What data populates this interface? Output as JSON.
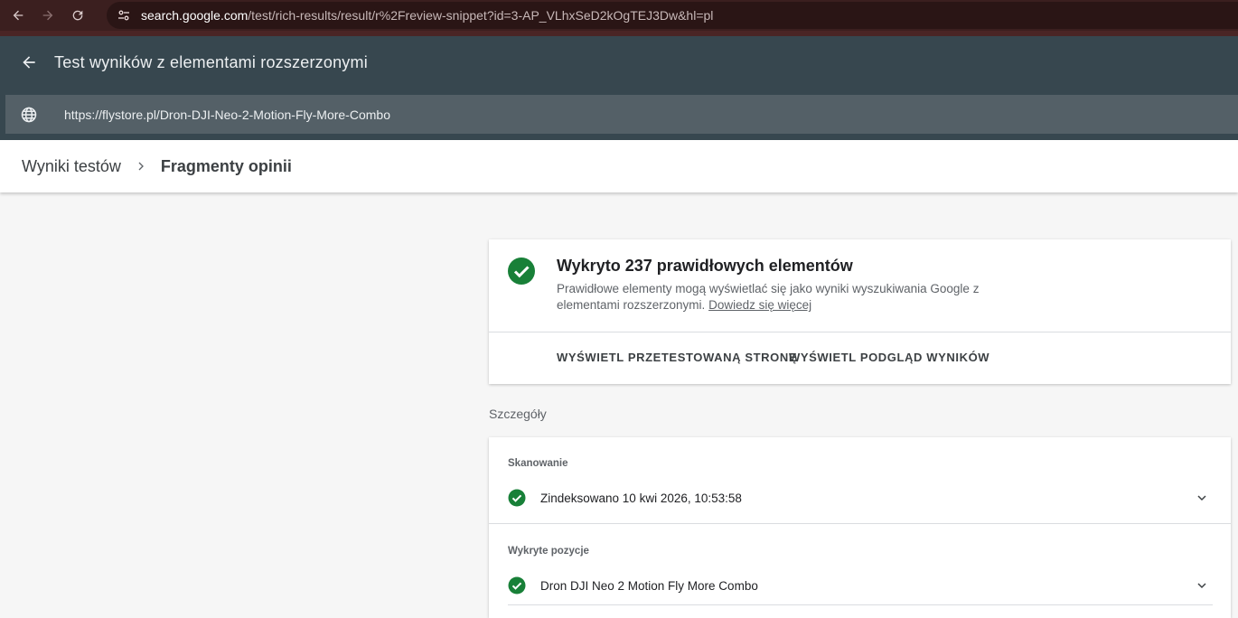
{
  "browser": {
    "url_host": "search.google.com",
    "url_path": "/test/rich-results/result/r%2Freview-snippet?id=3-AP_VLhxSeD2kOgTEJ3Dw&hl=pl"
  },
  "header": {
    "title": "Test wyników z elementami rozszerzonymi",
    "tested_url": "https://flystore.pl/Dron-DJI-Neo-2-Motion-Fly-More-Combo"
  },
  "breadcrumb": {
    "parent": "Wyniki testów",
    "current": "Fragmenty opinii"
  },
  "summary": {
    "title": "Wykryto 237 prawidłowych elementów",
    "description": "Prawidłowe elementy mogą wyświetlać się jako wyniki wyszukiwania Google z elementami rozszerzonymi.",
    "learn_more": "Dowiedz się więcej",
    "btn_view_page": "WYŚWIETL PRZETESTOWANĄ STRONĘ",
    "btn_view_preview": "WYŚWIETL PODGLĄD WYNIKÓW"
  },
  "details": {
    "label": "Szczegóły",
    "crawl_label": "Skanowanie",
    "crawl_value": "Zindeksowano 10 kwi 2026, 10:53:58",
    "items_label": "Wykryte pozycje",
    "items_value": "Dron DJI Neo 2 Motion Fly More Combo"
  },
  "colors": {
    "header_bg": "#37474f",
    "success_green": "#188038"
  }
}
